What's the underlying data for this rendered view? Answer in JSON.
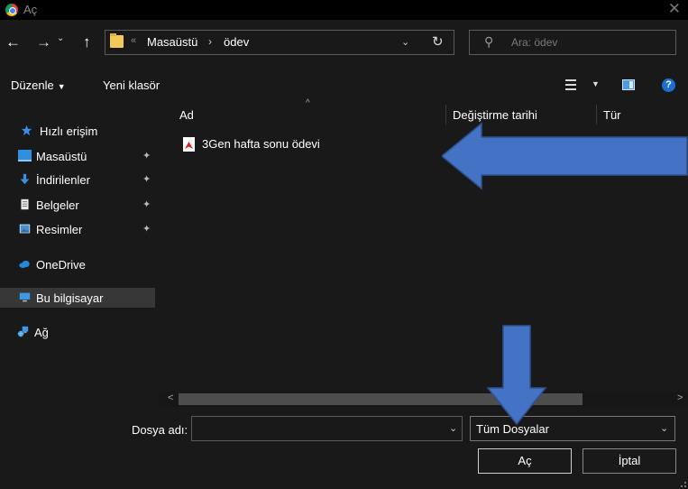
{
  "window": {
    "title": "Aç",
    "close_glyph": "✕"
  },
  "navigation": {
    "back_glyph": "←",
    "forward_glyph": "→",
    "recent_glyph": "⌄",
    "up_glyph": "↑",
    "breadcrumb_overflow": "«",
    "breadcrumb": [
      "Masaüstü",
      "ödev"
    ],
    "breadcrumb_separator": "›",
    "address_dropdown_glyph": "⌄",
    "refresh_glyph": "↻",
    "search_placeholder": "Ara: ödev",
    "search_glyph": "⚲"
  },
  "toolbar": {
    "organize_label": "Düzenle",
    "organize_caret": "▼",
    "new_folder_label": "Yeni klasör",
    "view_caret": "▼",
    "help_glyph": "?"
  },
  "sidebar": {
    "items": [
      {
        "label": "Hızlı erişim",
        "icon": "star-icon",
        "pinned": false
      },
      {
        "label": "Masaüstü",
        "icon": "desktop-icon",
        "pinned": true
      },
      {
        "label": "İndirilenler",
        "icon": "download-icon",
        "pinned": true
      },
      {
        "label": "Belgeler",
        "icon": "documents-icon",
        "pinned": true
      },
      {
        "label": "Resimler",
        "icon": "pictures-icon",
        "pinned": true
      },
      {
        "label": "OneDrive",
        "icon": "cloud-icon",
        "pinned": false
      },
      {
        "label": "Bu bilgisayar",
        "icon": "computer-icon",
        "pinned": false,
        "selected": true
      },
      {
        "label": "Ağ",
        "icon": "network-icon",
        "pinned": false
      }
    ],
    "pin_glyph": "✦"
  },
  "file_list": {
    "columns": [
      "Ad",
      "Değiştirme tarihi",
      "Tür"
    ],
    "sort_caret": "^",
    "files": [
      {
        "name": "3Gen hafta sonu ödevi",
        "icon": "pdf-icon"
      }
    ]
  },
  "scrollbar": {
    "left_glyph": "<",
    "right_glyph": ">"
  },
  "footer": {
    "filename_label": "Dosya adı:",
    "filename_value": "",
    "filename_dropdown_glyph": "⌄",
    "filetype_value": "Tüm Dosyalar",
    "filetype_dropdown_glyph": "⌄",
    "open_button": "Aç",
    "cancel_button": "İptal"
  },
  "colors": {
    "background": "#191919",
    "titlebar": "#000000",
    "annotation_arrow": "#4472c4",
    "selected_item": "#373737"
  }
}
